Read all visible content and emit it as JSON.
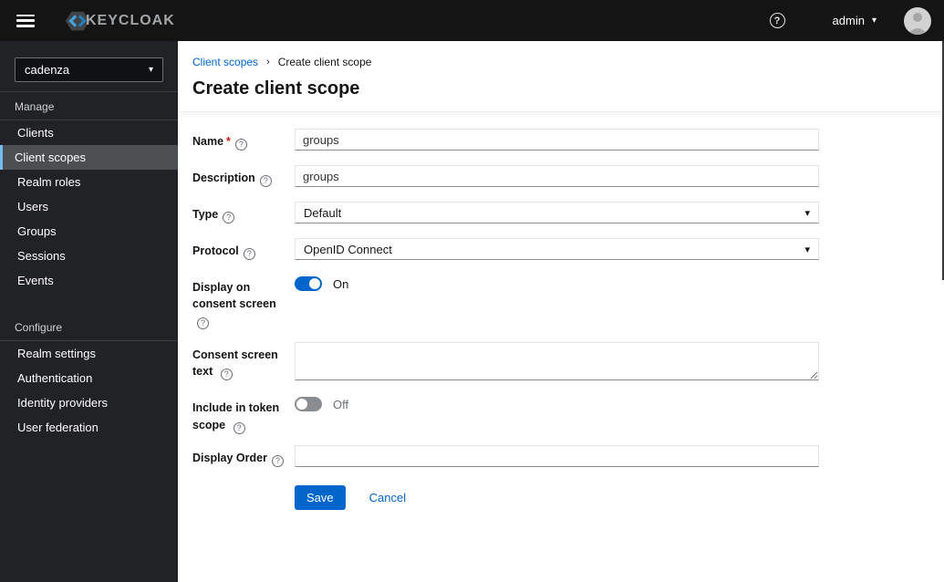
{
  "topbar": {
    "brand": "KEYCLOAK",
    "username": "admin"
  },
  "icons": {
    "help": "?",
    "caret": "▾",
    "breadcrumb_separator": "›"
  },
  "sidebar": {
    "realm_selector": {
      "value": "cadenza"
    },
    "sections": [
      {
        "label": "Manage",
        "items": [
          {
            "label": "Clients",
            "active": false
          },
          {
            "label": "Client scopes",
            "active": true
          },
          {
            "label": "Realm roles",
            "active": false
          },
          {
            "label": "Users",
            "active": false
          },
          {
            "label": "Groups",
            "active": false
          },
          {
            "label": "Sessions",
            "active": false
          },
          {
            "label": "Events",
            "active": false
          }
        ]
      },
      {
        "label": "Configure",
        "items": [
          {
            "label": "Realm settings",
            "active": false
          },
          {
            "label": "Authentication",
            "active": false
          },
          {
            "label": "Identity providers",
            "active": false
          },
          {
            "label": "User federation",
            "active": false
          }
        ]
      }
    ]
  },
  "breadcrumb": {
    "parent": "Client scopes",
    "current": "Create client scope"
  },
  "page": {
    "title": "Create client scope"
  },
  "form": {
    "name": {
      "label": "Name",
      "required_marker": "*",
      "value": "groups"
    },
    "description": {
      "label": "Description",
      "value": "groups"
    },
    "type": {
      "label": "Type",
      "value": "Default"
    },
    "protocol": {
      "label": "Protocol",
      "value": "OpenID Connect"
    },
    "display_on_consent_screen": {
      "label": "Display on consent screen",
      "state": "On"
    },
    "consent_screen_text": {
      "label": "Consent screen text",
      "value": ""
    },
    "include_in_token_scope": {
      "label": "Include in token scope",
      "state": "Off"
    },
    "display_order": {
      "label": "Display Order",
      "value": ""
    }
  },
  "actions": {
    "save": "Save",
    "cancel": "Cancel"
  },
  "colors": {
    "accent": "#0066cc",
    "active_nav_indicator": "#73bcf7",
    "required": "#c9190b",
    "toggle_off": "#8a8d90"
  }
}
